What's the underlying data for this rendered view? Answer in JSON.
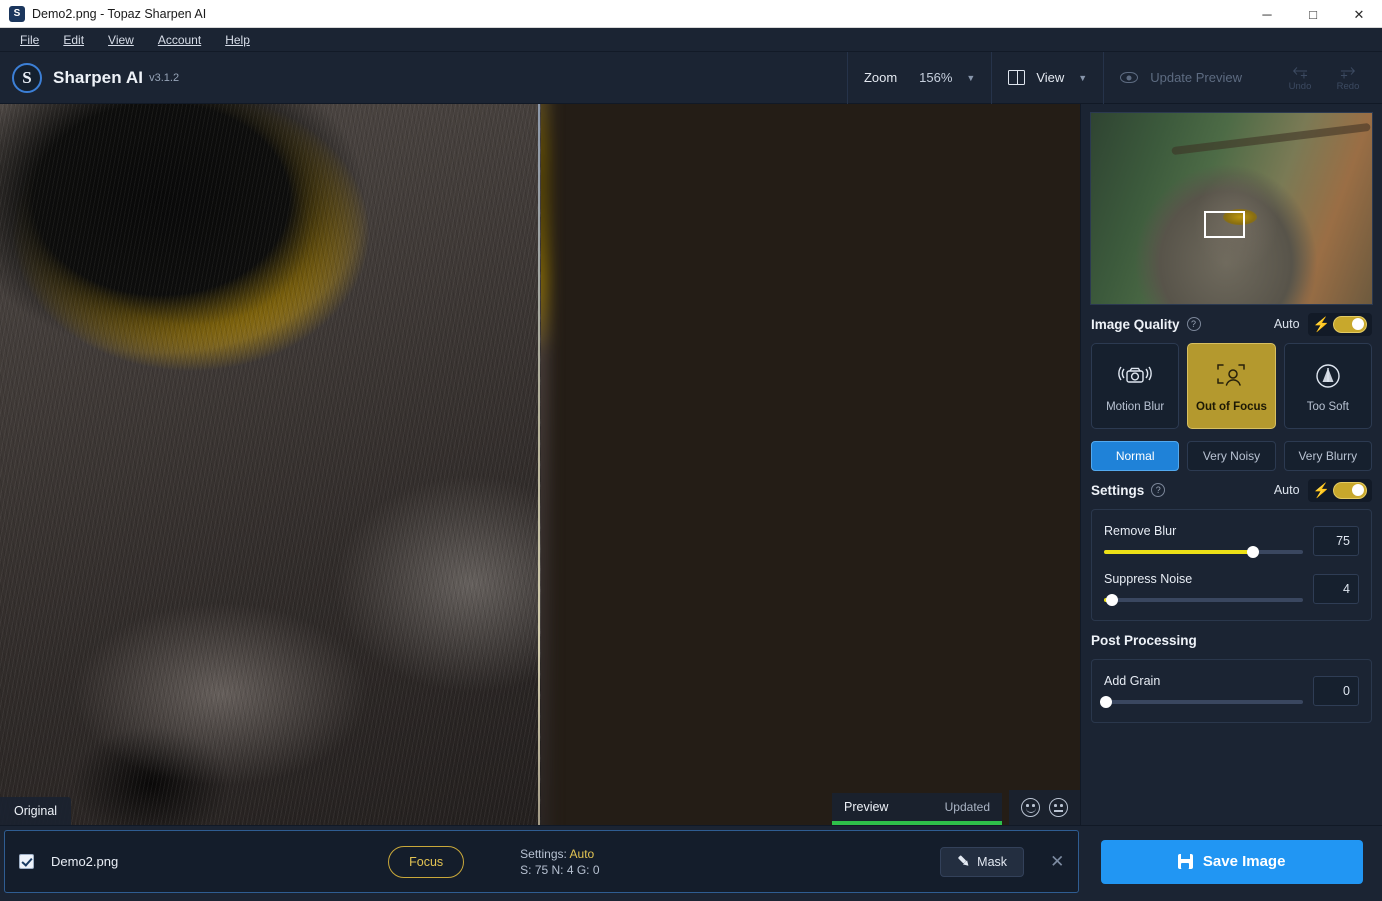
{
  "window": {
    "title": "Demo2.png - Topaz Sharpen AI",
    "app_icon": "S",
    "minimize": "─",
    "maximize": "□",
    "close": "✕"
  },
  "menubar": {
    "items": [
      {
        "label": "File",
        "mnemonic": "F"
      },
      {
        "label": "Edit",
        "mnemonic": "E"
      },
      {
        "label": "View",
        "mnemonic": "V"
      },
      {
        "label": "Account",
        "mnemonic": "A"
      },
      {
        "label": "Help",
        "mnemonic": "H"
      }
    ]
  },
  "appbar": {
    "brand": "Sharpen AI",
    "version": "v3.1.2",
    "zoom": {
      "label": "Zoom",
      "value": "156%"
    },
    "view": {
      "label": "View"
    },
    "update_preview": {
      "label": "Update Preview",
      "enabled": false
    },
    "undo": "Undo",
    "redo": "Redo"
  },
  "canvas": {
    "original_label": "Original",
    "preview_label": "Preview",
    "preview_status": "Updated"
  },
  "panel": {
    "image_quality": {
      "title": "Image Quality",
      "auto_label": "Auto",
      "auto_on": true,
      "cards": [
        {
          "label": "Motion Blur",
          "icon": "camera-shake-icon",
          "active": false
        },
        {
          "label": "Out of Focus",
          "icon": "focus-person-icon",
          "active": true
        },
        {
          "label": "Too Soft",
          "icon": "soft-cone-icon",
          "active": true
        }
      ],
      "modes": [
        {
          "label": "Normal",
          "active": true
        },
        {
          "label": "Very Noisy",
          "active": false
        },
        {
          "label": "Very Blurry",
          "active": false
        }
      ]
    },
    "settings": {
      "title": "Settings",
      "auto_label": "Auto",
      "auto_on": true,
      "sliders": [
        {
          "label": "Remove Blur",
          "value": 75,
          "percent": 75
        },
        {
          "label": "Suppress Noise",
          "value": 4,
          "percent": 4
        }
      ]
    },
    "post_processing": {
      "title": "Post Processing",
      "sliders": [
        {
          "label": "Add Grain",
          "value": 0,
          "percent": 0
        }
      ]
    }
  },
  "bottom": {
    "filename": "Demo2.png",
    "checked": true,
    "focus_label": "Focus",
    "settings_prefix": "Settings:",
    "settings_mode": "Auto",
    "settings_values": "S: 75  N: 4  G: 0",
    "mask_label": "Mask",
    "close_label": "✕",
    "save_label": "Save Image"
  }
}
